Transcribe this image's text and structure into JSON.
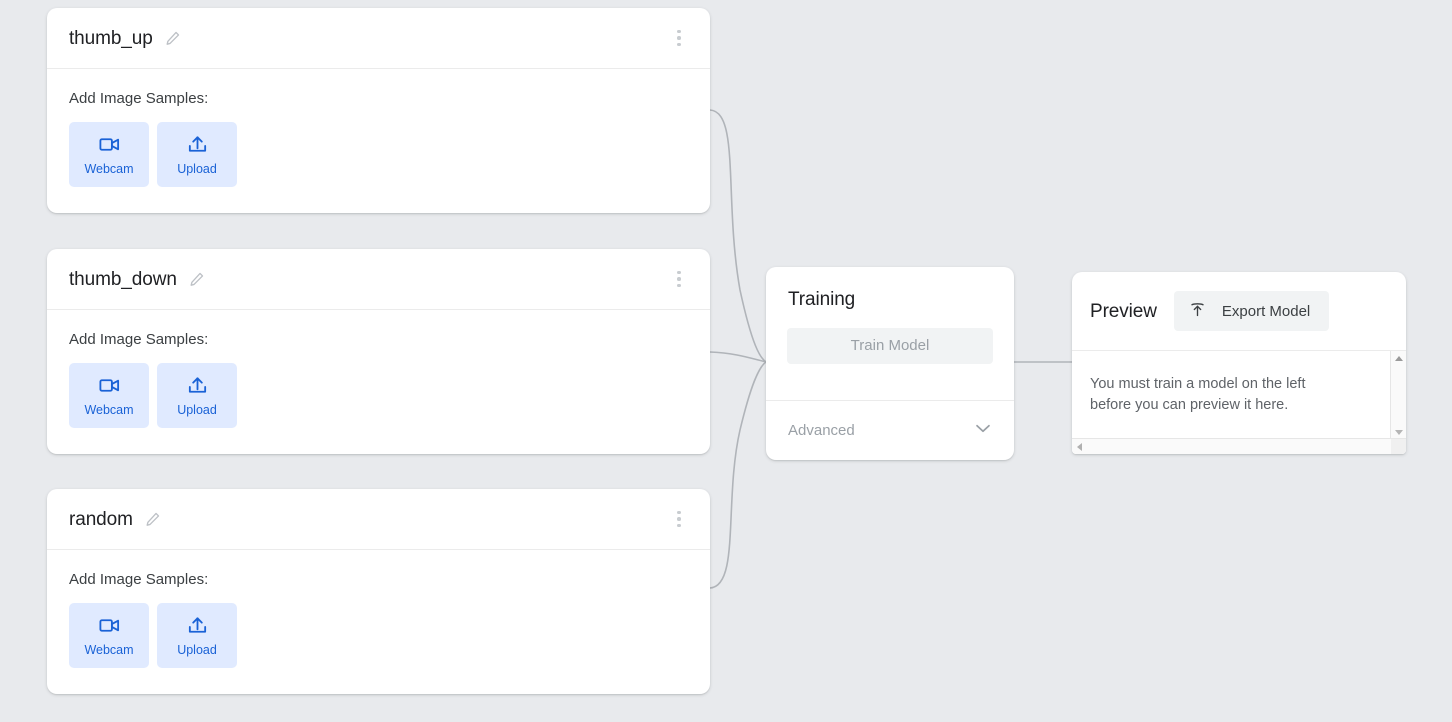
{
  "theme": {
    "background": "#e8eaed",
    "card_background": "#ffffff",
    "accent_blue": "#1a62d6",
    "sample_button_bg": "#e0eaff",
    "muted_text": "#9aa0a6",
    "body_text": "#5f6368",
    "title_text": "#202124"
  },
  "classes": [
    {
      "name": "thumb_up",
      "samples_label": "Add Image Samples:",
      "webcam_label": "Webcam",
      "upload_label": "Upload",
      "edit_icon": "pencil-icon",
      "menu_icon": "kebab-menu-icon"
    },
    {
      "name": "thumb_down",
      "samples_label": "Add Image Samples:",
      "webcam_label": "Webcam",
      "upload_label": "Upload",
      "edit_icon": "pencil-icon",
      "menu_icon": "kebab-menu-icon"
    },
    {
      "name": "random",
      "samples_label": "Add Image Samples:",
      "webcam_label": "Webcam",
      "upload_label": "Upload",
      "edit_icon": "pencil-icon",
      "menu_icon": "kebab-menu-icon"
    }
  ],
  "training": {
    "title": "Training",
    "train_button_label": "Train Model",
    "advanced_label": "Advanced",
    "advanced_chevron_icon": "chevron-down-icon"
  },
  "preview": {
    "title": "Preview",
    "export_button_label": "Export Model",
    "export_icon": "upload-arrow-icon",
    "message": "You must train a model on the left before you can preview it here.",
    "scrollbars": {
      "vertical_up_icon": "triangle-up-icon",
      "vertical_down_icon": "triangle-down-icon",
      "horizontal_left_icon": "triangle-left-icon",
      "horizontal_right_icon": "triangle-right-icon"
    }
  }
}
